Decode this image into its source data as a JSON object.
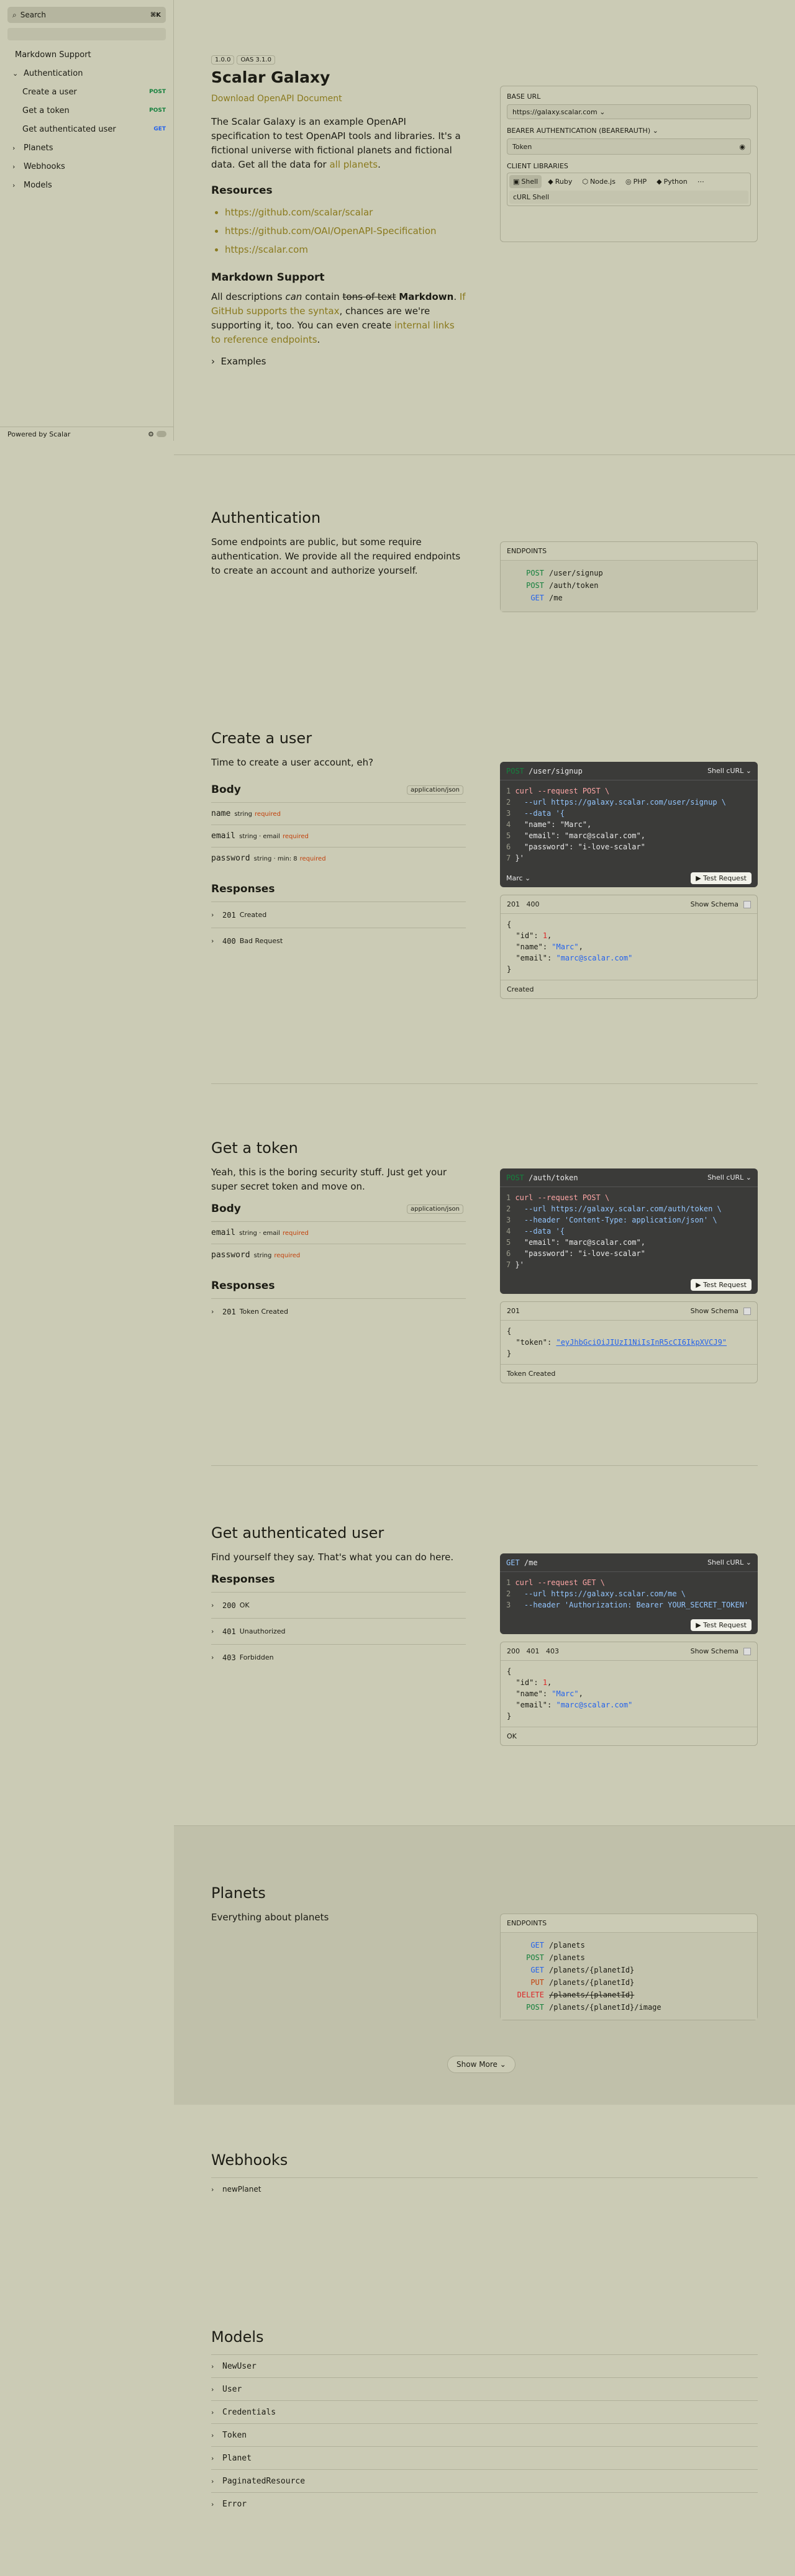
{
  "sidebar": {
    "search_label": "Search",
    "search_kbd": "⌘K",
    "items": [
      {
        "label": "Markdown Support"
      },
      {
        "label": "Authentication"
      },
      {
        "label": "Create a user",
        "method": "POST"
      },
      {
        "label": "Get a token",
        "method": "POST"
      },
      {
        "label": "Get authenticated user",
        "method": "GET"
      },
      {
        "label": "Planets"
      },
      {
        "label": "Webhooks"
      },
      {
        "label": "Models"
      }
    ],
    "footer": "Powered by Scalar"
  },
  "intro": {
    "version": "1.0.0",
    "oas": "OAS 3.1.0",
    "title": "Scalar Galaxy",
    "download": "Download OpenAPI Document",
    "desc_1": "The Scalar Galaxy is an example OpenAPI specification to test OpenAPI tools and libraries. It's a fictional universe with fictional planets and fictional data. Get all the data for ",
    "desc_link": "all planets",
    "desc_2": ".",
    "resources_title": "Resources",
    "resources": [
      "https://github.com/scalar/scalar",
      "https://github.com/OAI/OpenAPI-Specification",
      "https://scalar.com"
    ],
    "md_title": "Markdown Support",
    "md_1": "All descriptions ",
    "md_can": "can",
    "md_2": " contain ",
    "md_strike": "tons of text",
    "md_bold": "Markdown",
    "md_3": ". ",
    "md_link1": "If GitHub supports the syntax",
    "md_4": ", chances are we're supporting it, too. You can even create ",
    "md_link2": "internal links to reference endpoints",
    "md_5": ".",
    "examples": "Examples"
  },
  "config": {
    "base_url_label": "BASE URL",
    "base_url": "https://galaxy.scalar.com",
    "auth_label": "BEARER AUTHENTICATION (BEARERAUTH)",
    "token_placeholder": "Token",
    "client_label": "CLIENT LIBRARIES",
    "clients": [
      "Shell",
      "Ruby",
      "Node.js",
      "PHP",
      "Python"
    ],
    "client_sel": "cURL Shell"
  },
  "authentication": {
    "title": "Authentication",
    "desc": "Some endpoints are public, but some require authentication. We provide all the required endpoints to create an account and authorize yourself.",
    "endpoints_label": "ENDPOINTS",
    "endpoints": [
      {
        "method": "POST",
        "path": "/user/signup"
      },
      {
        "method": "POST",
        "path": "/auth/token"
      },
      {
        "method": "GET",
        "path": "/me"
      }
    ]
  },
  "create_user": {
    "title": "Create a user",
    "desc": "Time to create a user account, eh?",
    "body_label": "Body",
    "content_type": "application/json",
    "fields": [
      {
        "name": "name",
        "type": "string",
        "extra": "",
        "req": "required"
      },
      {
        "name": "email",
        "type": "string · email",
        "extra": "",
        "req": "required"
      },
      {
        "name": "password",
        "type": "string · min: 8",
        "extra": "",
        "req": "required"
      }
    ],
    "responses_label": "Responses",
    "responses": [
      {
        "status": "201",
        "desc": "Created"
      },
      {
        "status": "400",
        "desc": "Bad Request"
      }
    ],
    "req_method": "POST",
    "req_path": "/user/signup",
    "lang": "Shell cURL",
    "code": [
      "curl --request POST \\",
      "  --url https://galaxy.scalar.com/user/signup \\",
      "  --data '{",
      "  \"name\": \"Marc\",",
      "  \"email\": \"marc@scalar.com\",",
      "  \"password\": \"i-love-scalar\"",
      "}'"
    ],
    "example_label": "Marc",
    "test_btn": "Test Request",
    "resp_tabs": "201   400",
    "show_schema": "Show Schema",
    "resp_json_id": "1",
    "resp_json_name": "\"Marc\"",
    "resp_json_email": "\"marc@scalar.com\"",
    "resp_footer": "Created"
  },
  "get_token": {
    "title": "Get a token",
    "desc": "Yeah, this is the boring security stuff. Just get your super secret token and move on.",
    "body_label": "Body",
    "content_type": "application/json",
    "fields": [
      {
        "name": "email",
        "type": "string · email",
        "req": "required"
      },
      {
        "name": "password",
        "type": "string",
        "req": "required"
      }
    ],
    "responses_label": "Responses",
    "responses": [
      {
        "status": "201",
        "desc": "Token Created"
      }
    ],
    "req_method": "POST",
    "req_path": "/auth/token",
    "lang": "Shell cURL",
    "code": [
      "curl --request POST \\",
      "  --url https://galaxy.scalar.com/auth/token \\",
      "  --header 'Content-Type: application/json' \\",
      "  --data '{",
      "  \"email\": \"marc@scalar.com\",",
      "  \"password\": \"i-love-scalar\"",
      "}'"
    ],
    "test_btn": "Test Request",
    "resp_tabs": "201",
    "show_schema": "Show Schema",
    "resp_token": "\"eyJhbGciOiJIUzI1NiIsInR5cCI6IkpXVCJ9\"",
    "resp_footer": "Token Created"
  },
  "get_me": {
    "title": "Get authenticated user",
    "desc": "Find yourself they say. That's what you can do here.",
    "responses_label": "Responses",
    "responses": [
      {
        "status": "200",
        "desc": "OK"
      },
      {
        "status": "401",
        "desc": "Unauthorized"
      },
      {
        "status": "403",
        "desc": "Forbidden"
      }
    ],
    "req_method": "GET",
    "req_path": "/me",
    "lang": "Shell cURL",
    "code": [
      "curl --request GET \\",
      "  --url https://galaxy.scalar.com/me \\",
      "  --header 'Authorization: Bearer YOUR_SECRET_TOKEN'"
    ],
    "test_btn": "Test Request",
    "resp_tabs": "200   401   403",
    "show_schema": "Show Schema",
    "resp_json_id": "1",
    "resp_json_name": "\"Marc\"",
    "resp_json_email": "\"marc@scalar.com\"",
    "resp_footer": "OK"
  },
  "planets": {
    "title": "Planets",
    "desc": "Everything about planets",
    "endpoints_label": "ENDPOINTS",
    "endpoints": [
      {
        "method": "GET",
        "path": "/planets"
      },
      {
        "method": "POST",
        "path": "/planets"
      },
      {
        "method": "GET",
        "path": "/planets/{planetId}"
      },
      {
        "method": "PUT",
        "path": "/planets/{planetId}"
      },
      {
        "method": "DELETE",
        "path": "/planets/{planetId}"
      },
      {
        "method": "POST",
        "path": "/planets/{planetId}/image"
      }
    ],
    "show_more": "Show More"
  },
  "webhooks": {
    "title": "Webhooks",
    "items": [
      "newPlanet"
    ]
  },
  "models": {
    "title": "Models",
    "items": [
      "NewUser",
      "User",
      "Credentials",
      "Token",
      "Planet",
      "PaginatedResource",
      "Error"
    ]
  }
}
